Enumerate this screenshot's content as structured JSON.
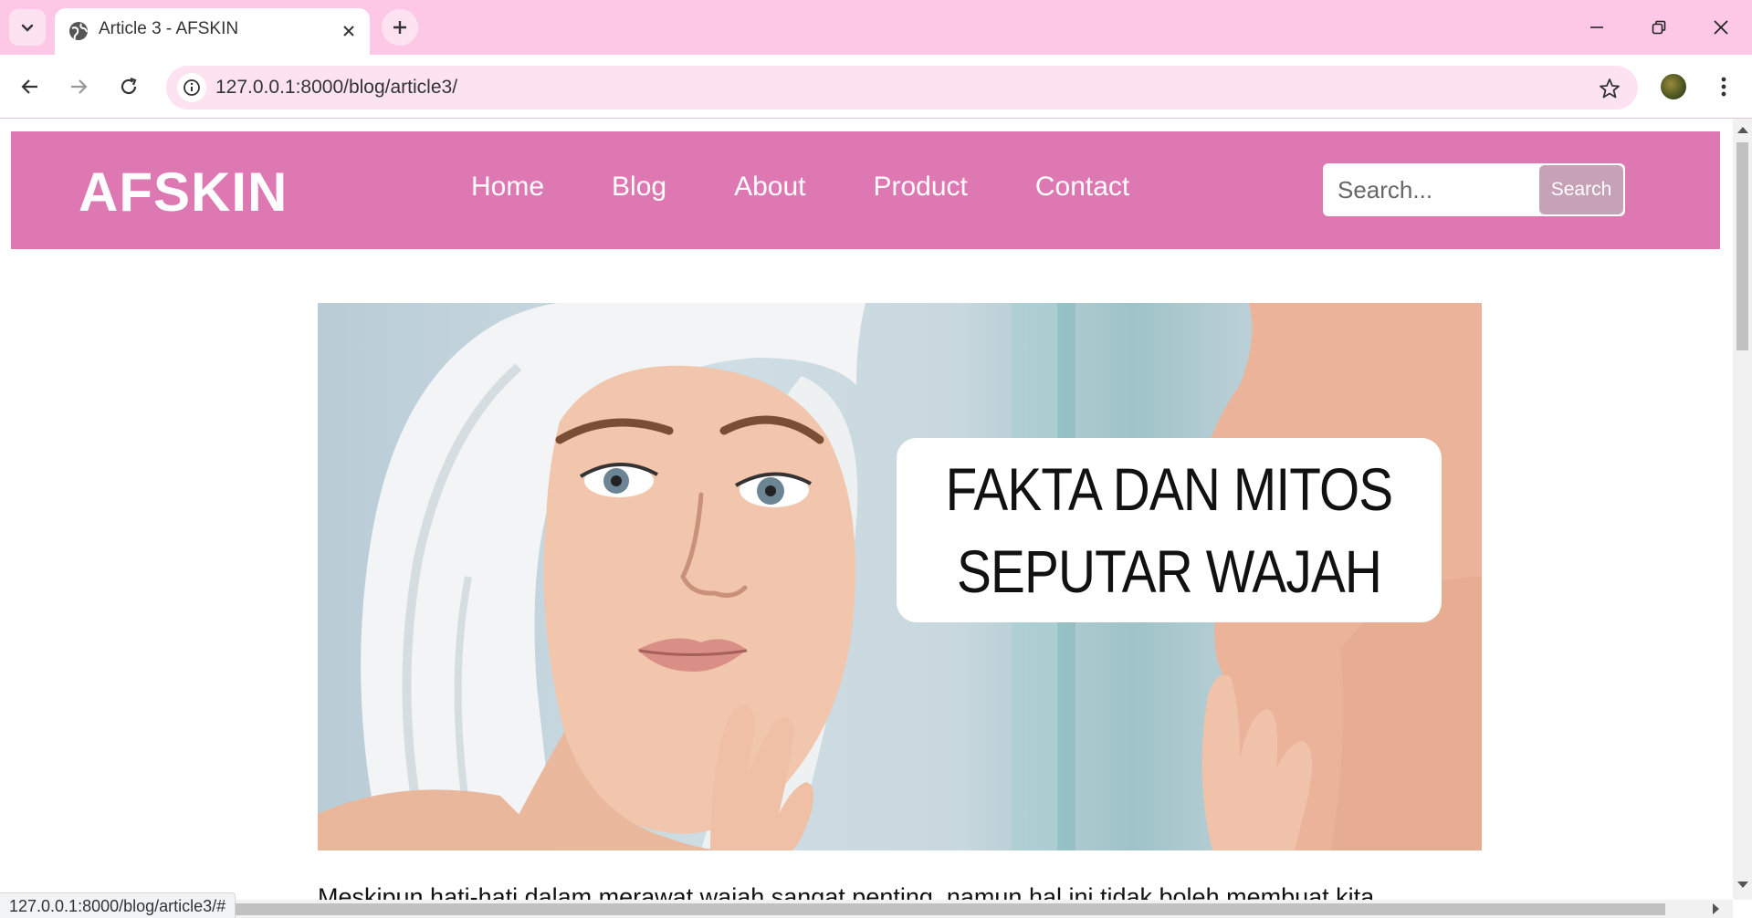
{
  "browser": {
    "tab_title": "Article 3 - AFSKIN",
    "url": "127.0.0.1:8000/blog/article3/",
    "status_url": "127.0.0.1:8000/blog/article3/#",
    "icons": {
      "tab_list": "chevron-down-icon",
      "favicon": "globe-icon",
      "tab_close": "close-icon",
      "new_tab": "plus-icon",
      "minimize": "minimize-icon",
      "restore": "restore-icon",
      "close_window": "close-icon",
      "back": "arrow-left-icon",
      "forward": "arrow-right-icon",
      "reload": "reload-icon",
      "site_info": "info-icon",
      "bookmark": "star-icon",
      "menu": "kebab-icon"
    },
    "colors": {
      "frame": "#fcc8e6",
      "omnibox": "#fde3f2"
    }
  },
  "site": {
    "logo": "AFSKIN",
    "nav": [
      "Home",
      "Blog",
      "About",
      "Product",
      "Contact"
    ],
    "search": {
      "placeholder": "Search...",
      "button": "Search"
    },
    "colors": {
      "header": "#de78b3",
      "search_button": "#c6a2b8"
    }
  },
  "article": {
    "hero_caption_line1": "FAKTA DAN MITOS",
    "hero_caption_line2": "SEPUTAR WAJAH",
    "first_line": "Meskipun hati-hati dalam merawat wajah sangat penting, namun hal ini tidak boleh membuat kita"
  }
}
